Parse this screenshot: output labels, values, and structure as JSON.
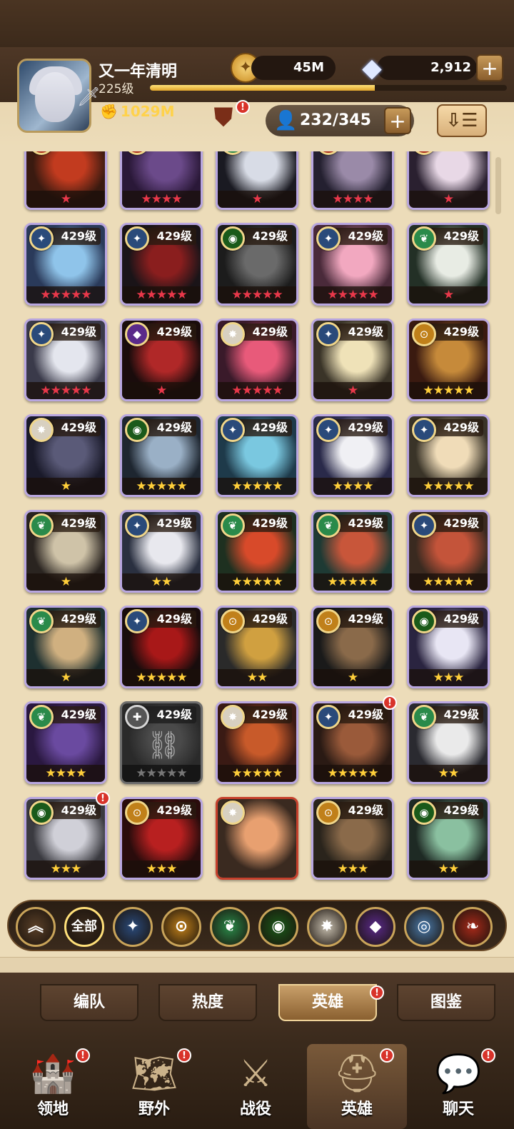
{
  "player": {
    "name": "又一年清明",
    "level": "225级",
    "power": "1029M",
    "xp_fraction": 0.63
  },
  "resources": {
    "gold": "45M",
    "diamonds": "2,912",
    "hero_count": "232/345"
  },
  "top_badges": {
    "chest": "!"
  },
  "colors": {
    "wood_dark": "#3a2a1c",
    "parchment": "#ecdcb9",
    "card_border": "#b8a6e0",
    "star_red": "#e8384a",
    "star_gold": "#ffcf3a",
    "badge_red": "#d8332a"
  },
  "heroes": [
    {
      "level": "",
      "faction": "abyss",
      "stars": "★",
      "star_color": "red",
      "palette": [
        "#3a1a10",
        "#c23b1f"
      ],
      "badge": false,
      "partial": true
    },
    {
      "level": "",
      "faction": "abyss",
      "stars": "★★★★",
      "star_color": "red",
      "palette": [
        "#2a1838",
        "#6b4a8a"
      ],
      "badge": false,
      "partial": true
    },
    {
      "level": "",
      "faction": "wilder",
      "stars": "★",
      "star_color": "red",
      "palette": [
        "#1a1a22",
        "#d8dce6"
      ],
      "badge": false,
      "partial": true
    },
    {
      "level": "",
      "faction": "abyss",
      "stars": "★★★★",
      "star_color": "red",
      "palette": [
        "#242030",
        "#9a8aa8"
      ],
      "badge": false,
      "partial": true
    },
    {
      "level": "",
      "faction": "abyss",
      "stars": "★",
      "star_color": "red",
      "palette": [
        "#2a2030",
        "#e8d8e6"
      ],
      "badge": false,
      "partial": true
    },
    {
      "level": "429级",
      "faction": "lightbearer",
      "stars": "★★★★★",
      "star_color": "red",
      "palette": [
        "#2a3a5a",
        "#8fc4ea"
      ],
      "badge": false
    },
    {
      "level": "429级",
      "faction": "lightbearer",
      "stars": "★★★★★",
      "star_color": "red",
      "palette": [
        "#1a1418",
        "#8a1e1e"
      ],
      "badge": false
    },
    {
      "level": "429级",
      "faction": "graveborn",
      "stars": "★★★★★",
      "star_color": "red",
      "palette": [
        "#1c1c1c",
        "#6a6a6a"
      ],
      "badge": false
    },
    {
      "level": "429级",
      "faction": "lightbearer",
      "stars": "★★★★★",
      "star_color": "red",
      "palette": [
        "#4a2a3a",
        "#f2a8c0"
      ],
      "badge": false
    },
    {
      "level": "429级",
      "faction": "wilder",
      "stars": "★",
      "star_color": "red",
      "palette": [
        "#233026",
        "#e8ece4"
      ],
      "badge": false
    },
    {
      "level": "429级",
      "faction": "lightbearer",
      "stars": "★★★★★",
      "star_color": "red",
      "palette": [
        "#3a3a4a",
        "#e4e6ee"
      ],
      "badge": false
    },
    {
      "level": "429级",
      "faction": "hypogean",
      "stars": "★",
      "star_color": "red",
      "palette": [
        "#1a0c0c",
        "#b02828"
      ],
      "badge": false
    },
    {
      "level": "429级",
      "faction": "celestial",
      "stars": "★★★★★",
      "star_color": "red",
      "palette": [
        "#3a1a2a",
        "#e85a7a"
      ],
      "badge": false
    },
    {
      "level": "429级",
      "faction": "lightbearer",
      "stars": "★",
      "star_color": "red",
      "palette": [
        "#3a3428",
        "#efe2b8"
      ],
      "badge": false
    },
    {
      "level": "429级",
      "faction": "mauler",
      "stars": "★★★★★",
      "star_color": "gold",
      "palette": [
        "#3a1a10",
        "#c68a3a"
      ],
      "badge": false
    },
    {
      "level": "429级",
      "faction": "celestial",
      "stars": "★",
      "star_color": "gold",
      "palette": [
        "#1a1a2a",
        "#5a5a78"
      ],
      "badge": false
    },
    {
      "level": "429级",
      "faction": "graveborn",
      "stars": "★★★★★",
      "star_color": "gold",
      "palette": [
        "#1e2630",
        "#9ab0c6"
      ],
      "badge": false
    },
    {
      "level": "429级",
      "faction": "lightbearer",
      "stars": "★★★★★",
      "star_color": "gold",
      "palette": [
        "#1e3a4a",
        "#7ac8e0"
      ],
      "badge": false
    },
    {
      "level": "429级",
      "faction": "lightbearer",
      "stars": "★★★★",
      "star_color": "gold",
      "palette": [
        "#2a2a4a",
        "#f0f0f4"
      ],
      "badge": false
    },
    {
      "level": "429级",
      "faction": "lightbearer",
      "stars": "★★★★★",
      "star_color": "gold",
      "palette": [
        "#3a3428",
        "#f0dcb8"
      ],
      "badge": false
    },
    {
      "level": "429级",
      "faction": "wilder",
      "stars": "★",
      "star_color": "gold",
      "palette": [
        "#2a2420",
        "#cfc3a8"
      ],
      "badge": false
    },
    {
      "level": "429级",
      "faction": "lightbearer",
      "stars": "★★",
      "star_color": "gold",
      "palette": [
        "#2a3040",
        "#e8e8ee"
      ],
      "badge": false
    },
    {
      "level": "429级",
      "faction": "wilder",
      "stars": "★★★★★",
      "star_color": "gold",
      "palette": [
        "#1e3020",
        "#d84a2a"
      ],
      "badge": false
    },
    {
      "level": "429级",
      "faction": "wilder",
      "stars": "★★★★★",
      "star_color": "gold",
      "palette": [
        "#1e3a34",
        "#c8563a"
      ],
      "badge": false
    },
    {
      "level": "429级",
      "faction": "lightbearer",
      "stars": "★★★★★",
      "star_color": "gold",
      "palette": [
        "#3a2a20",
        "#c4543a"
      ],
      "badge": false
    },
    {
      "level": "429级",
      "faction": "wilder",
      "stars": "★",
      "star_color": "gold",
      "palette": [
        "#1e3030",
        "#d0b080"
      ],
      "badge": false
    },
    {
      "level": "429级",
      "faction": "lightbearer",
      "stars": "★★★★★",
      "star_color": "gold",
      "palette": [
        "#180c0c",
        "#a81818"
      ],
      "badge": false
    },
    {
      "level": "429级",
      "faction": "mauler",
      "stars": "★★",
      "star_color": "gold",
      "palette": [
        "#2a2a2a",
        "#d0a040"
      ],
      "badge": false
    },
    {
      "level": "429级",
      "faction": "mauler",
      "stars": "★",
      "star_color": "gold",
      "palette": [
        "#1a1a1a",
        "#8a6a4a"
      ],
      "badge": false
    },
    {
      "level": "429级",
      "faction": "graveborn",
      "stars": "★★★",
      "star_color": "gold",
      "palette": [
        "#2a2440",
        "#e8e6f4"
      ],
      "badge": false
    },
    {
      "level": "429级",
      "faction": "wilder",
      "stars": "★★★★",
      "star_color": "gold",
      "palette": [
        "#2a1840",
        "#6a4aa0"
      ],
      "badge": false
    },
    {
      "level": "429级",
      "faction": "locked",
      "stars": "★★★★★",
      "star_color": "gray",
      "palette": [
        "#2a2a2a",
        "#4a4a4a"
      ],
      "badge": false,
      "locked": true
    },
    {
      "level": "429级",
      "faction": "celestial",
      "stars": "★★★★★",
      "star_color": "gold",
      "palette": [
        "#3a1a14",
        "#c85a2a"
      ],
      "badge": false
    },
    {
      "level": "429级",
      "faction": "lightbearer",
      "stars": "★★★★★",
      "star_color": "gold",
      "palette": [
        "#2a1a14",
        "#9a5a3a"
      ],
      "badge": true
    },
    {
      "level": "429级",
      "faction": "wilder",
      "stars": "★★",
      "star_color": "gold",
      "palette": [
        "#2a2a30",
        "#eaeaea"
      ],
      "badge": false
    },
    {
      "level": "429级",
      "faction": "graveborn",
      "stars": "★★★",
      "star_color": "gold",
      "palette": [
        "#3a3a40",
        "#d0d0d8"
      ],
      "badge": true
    },
    {
      "level": "429级",
      "faction": "mauler",
      "stars": "★★★",
      "star_color": "gold",
      "palette": [
        "#2a0c0c",
        "#b82020"
      ],
      "badge": false
    },
    {
      "level": "",
      "faction": "celestial",
      "stars": "",
      "star_color": "gold",
      "palette": [
        "#3a2a20",
        "#e8a070"
      ],
      "badge": false,
      "special": true
    },
    {
      "level": "429级",
      "faction": "mauler",
      "stars": "★★★",
      "star_color": "gold",
      "palette": [
        "#2a241c",
        "#8a6a4a"
      ],
      "badge": false
    },
    {
      "level": "429级",
      "faction": "graveborn",
      "stars": "★★",
      "star_color": "gold",
      "palette": [
        "#1e2a24",
        "#8ac0a0"
      ],
      "badge": false
    }
  ],
  "filters": [
    {
      "name": "filter-collapse",
      "label": "︽",
      "bg": "#5a4028"
    },
    {
      "name": "filter-all",
      "label": "全部",
      "bg": "#3a2a1c"
    },
    {
      "name": "filter-lightbearer",
      "label": "✦",
      "bg": "#2a4a7a"
    },
    {
      "name": "filter-mauler",
      "label": "⊙",
      "bg": "#c0801a"
    },
    {
      "name": "filter-wilder",
      "label": "❦",
      "bg": "#2a8a4a"
    },
    {
      "name": "filter-graveborn",
      "label": "◉",
      "bg": "#1a5a1a"
    },
    {
      "name": "filter-celestial",
      "label": "✸",
      "bg": "#c8c0b0"
    },
    {
      "name": "filter-hypogean",
      "label": "◆",
      "bg": "#5a2a8a"
    },
    {
      "name": "filter-dimensional",
      "label": "◎",
      "bg": "#4a7aaa"
    },
    {
      "name": "filter-abyss",
      "label": "❧",
      "bg": "#a82a1a"
    }
  ],
  "tabs": [
    "编队",
    "热度",
    "英雄",
    "图鉴"
  ],
  "nav": [
    "领地",
    "野外",
    "战役",
    "英雄",
    "聊天"
  ]
}
